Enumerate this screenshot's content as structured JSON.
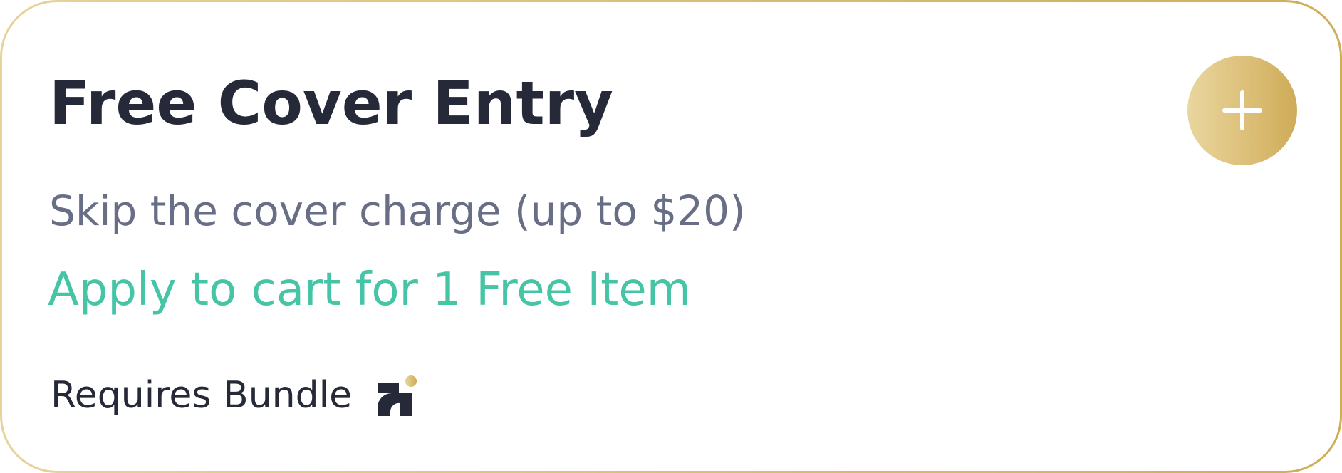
{
  "offer": {
    "title": "Free Cover Entry",
    "subtitle": "Skip the cover charge (up to $20)",
    "apply_label": "Apply to cart for 1 Free Item",
    "requires_label": "Requires Bundle",
    "add_icon": "plus-icon",
    "bundle_icon": "bundle-logo-icon"
  },
  "colors": {
    "title": "#262a38",
    "subtitle": "#676e86",
    "accent_green": "#45c4a6",
    "gold_light": "#e9d69e",
    "gold_dark": "#ceab57"
  }
}
